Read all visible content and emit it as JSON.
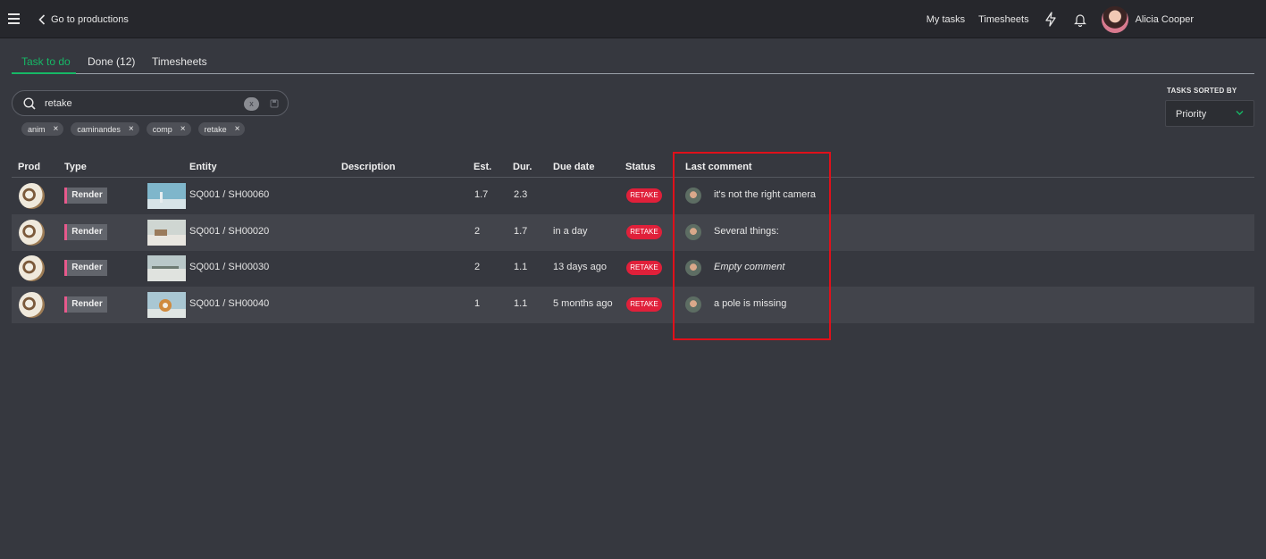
{
  "topbar": {
    "back_label": "Go to productions",
    "nav_my_tasks": "My tasks",
    "nav_timesheets": "Timesheets",
    "user_name": "Alicia Cooper"
  },
  "tabs": [
    {
      "label": "Task to do",
      "active": true
    },
    {
      "label": "Done (12)",
      "active": false
    },
    {
      "label": "Timesheets",
      "active": false
    }
  ],
  "search": {
    "value": "retake",
    "clear_label": "x"
  },
  "chips": [
    {
      "label": "anim"
    },
    {
      "label": "caminandes"
    },
    {
      "label": "comp"
    },
    {
      "label": "retake"
    }
  ],
  "sort": {
    "label": "TASKS SORTED BY",
    "value": "Priority"
  },
  "table": {
    "headers": {
      "prod": "Prod",
      "type": "Type",
      "entity": "Entity",
      "description": "Description",
      "est": "Est.",
      "dur": "Dur.",
      "due": "Due date",
      "status": "Status",
      "comment": "Last comment"
    },
    "rows": [
      {
        "type": "Render",
        "entity": "SQ001 / SH00060",
        "description": "",
        "est": "1.7",
        "dur": "2.3",
        "due": "",
        "status": "RETAKE",
        "comment": "it's not the right camera"
      },
      {
        "type": "Render",
        "entity": "SQ001 / SH00020",
        "description": "",
        "est": "2",
        "dur": "1.7",
        "due": "in a day",
        "status": "RETAKE",
        "comment": "Several things:"
      },
      {
        "type": "Render",
        "entity": "SQ001 / SH00030",
        "description": "",
        "est": "2",
        "dur": "1.1",
        "due": "13 days ago",
        "status": "RETAKE",
        "comment": "Empty comment"
      },
      {
        "type": "Render",
        "entity": "SQ001 / SH00040",
        "description": "",
        "est": "1",
        "dur": "1.1",
        "due": "5 months ago",
        "status": "RETAKE",
        "comment": "a pole is missing"
      }
    ]
  },
  "colors": {
    "accent": "#16b866",
    "retake": "#e0203a",
    "render_border": "#e7598c",
    "highlight": "#e0101a"
  }
}
